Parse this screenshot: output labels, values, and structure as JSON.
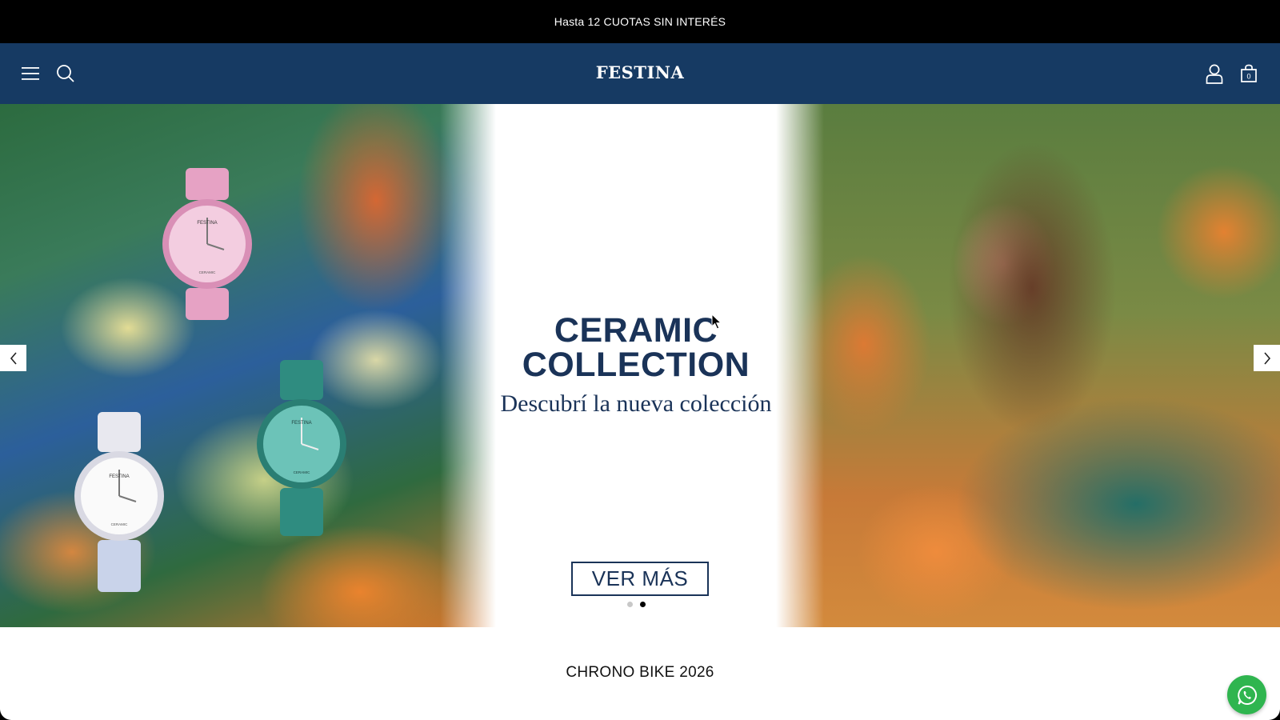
{
  "announcement": {
    "text": "Hasta 12 CUOTAS SIN INTERÉS"
  },
  "header": {
    "logo": "FESTINA",
    "cart_count": "0",
    "icons": [
      "menu-icon",
      "search-icon",
      "account-icon",
      "cart-icon"
    ]
  },
  "hero": {
    "title_line1": "CERAMIC",
    "title_line2": "COLLECTION",
    "subtitle": "Descubrí la nueva colección",
    "cta_label": "VER MÁS",
    "slides_total": 2,
    "active_slide": 2,
    "watch_brand": "FESTINA",
    "watch_model": "CERAMIC"
  },
  "section": {
    "title": "CHRONO BIKE 2026"
  },
  "colors": {
    "header_bg": "#163a63",
    "announcement_bg": "#000000",
    "title_color": "#1a3358",
    "whatsapp": "#2fb54f"
  }
}
